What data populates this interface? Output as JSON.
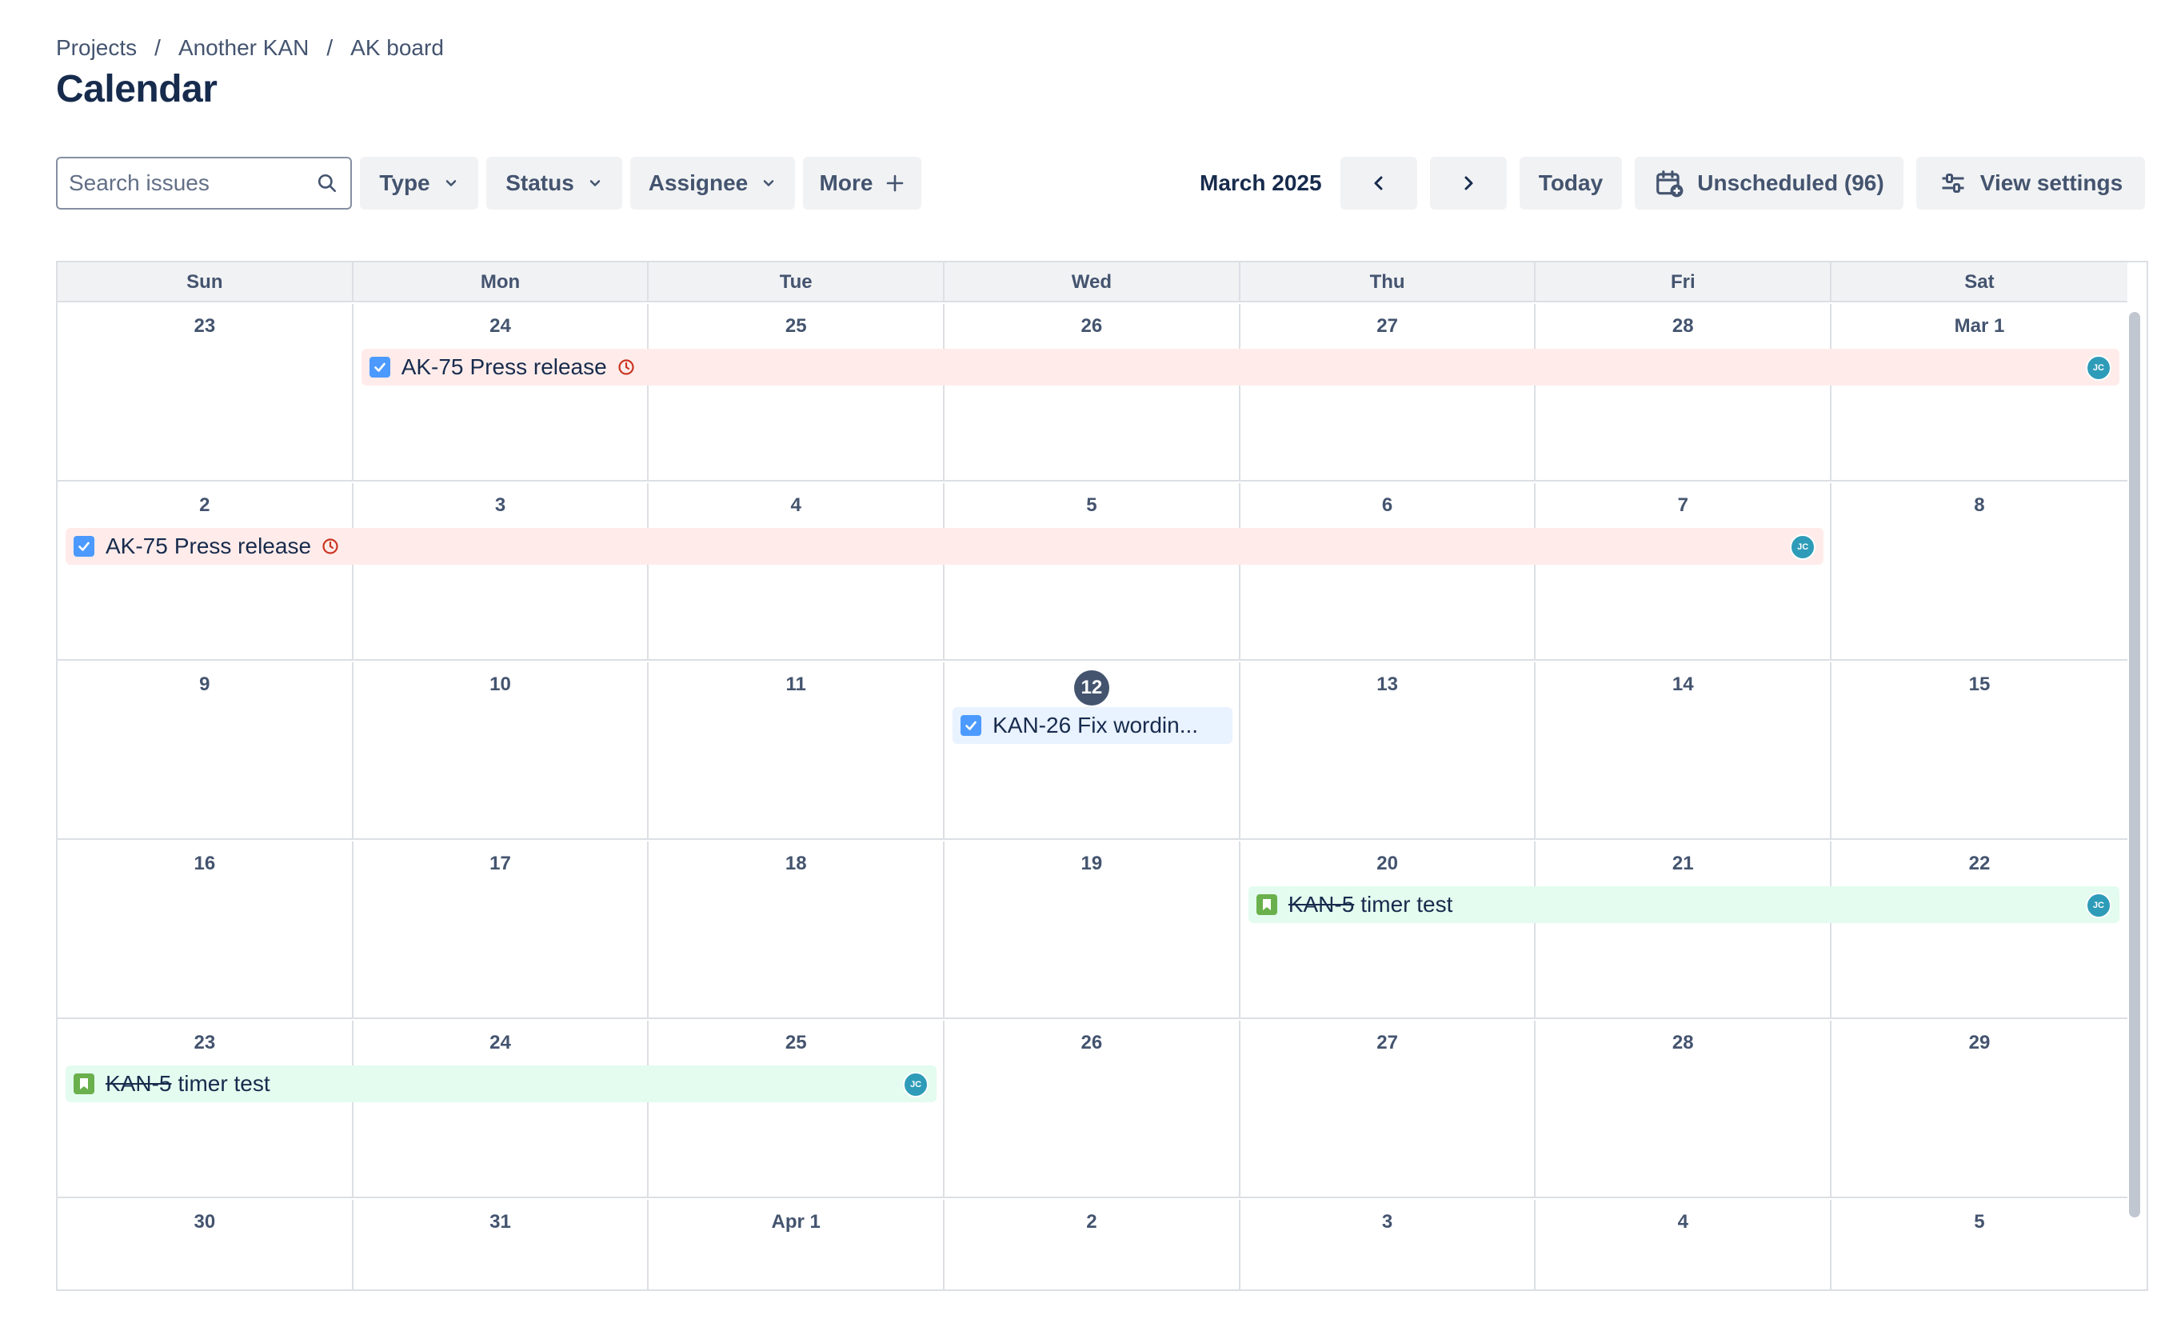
{
  "breadcrumb": {
    "projects": "Projects",
    "project": "Another KAN",
    "board": "AK board",
    "separator": "/"
  },
  "page_title": "Calendar",
  "toolbar": {
    "search_placeholder": "Search issues",
    "type_label": "Type",
    "status_label": "Status",
    "assignee_label": "Assignee",
    "more_label": "More",
    "month_label": "March 2025",
    "today_label": "Today",
    "unscheduled_label": "Unscheduled (96)",
    "view_settings_label": "View settings"
  },
  "weekdays": [
    "Sun",
    "Mon",
    "Tue",
    "Wed",
    "Thu",
    "Fri",
    "Sat"
  ],
  "weeks": [
    [
      "23",
      "24",
      "25",
      "26",
      "27",
      "28",
      "Mar 1"
    ],
    [
      "2",
      "3",
      "4",
      "5",
      "6",
      "7",
      "8"
    ],
    [
      "9",
      "10",
      "11",
      "12",
      "13",
      "14",
      "15"
    ],
    [
      "16",
      "17",
      "18",
      "19",
      "20",
      "21",
      "22"
    ],
    [
      "23",
      "24",
      "25",
      "26",
      "27",
      "28",
      "29"
    ],
    [
      "30",
      "31",
      "Apr 1",
      "2",
      "3",
      "4",
      "5"
    ]
  ],
  "today": {
    "week": 2,
    "day": 3
  },
  "events": [
    {
      "key": "AK-75",
      "title": "Press release",
      "color": "red",
      "type": "task",
      "done": false,
      "overdue": true,
      "avatar": "JC"
    },
    {
      "key": "AK-75",
      "title": "Press release",
      "color": "red",
      "type": "task",
      "done": false,
      "overdue": true,
      "avatar": "JC"
    },
    {
      "key": "KAN-26",
      "title": "Fix wordin...",
      "color": "blue",
      "type": "task",
      "done": false,
      "overdue": false,
      "avatar": ""
    },
    {
      "key": "KAN-5",
      "title": "timer test",
      "color": "green",
      "type": "story",
      "done": true,
      "overdue": false,
      "avatar": "JC"
    },
    {
      "key": "KAN-5",
      "title": "timer test",
      "color": "green",
      "type": "story",
      "done": true,
      "overdue": false,
      "avatar": "JC"
    }
  ],
  "colors": {
    "overdue": "#ca3521",
    "task": "#4c9aff",
    "story": "#6ab04c",
    "avatar": "#2e9cb8",
    "today": "#44546f"
  }
}
